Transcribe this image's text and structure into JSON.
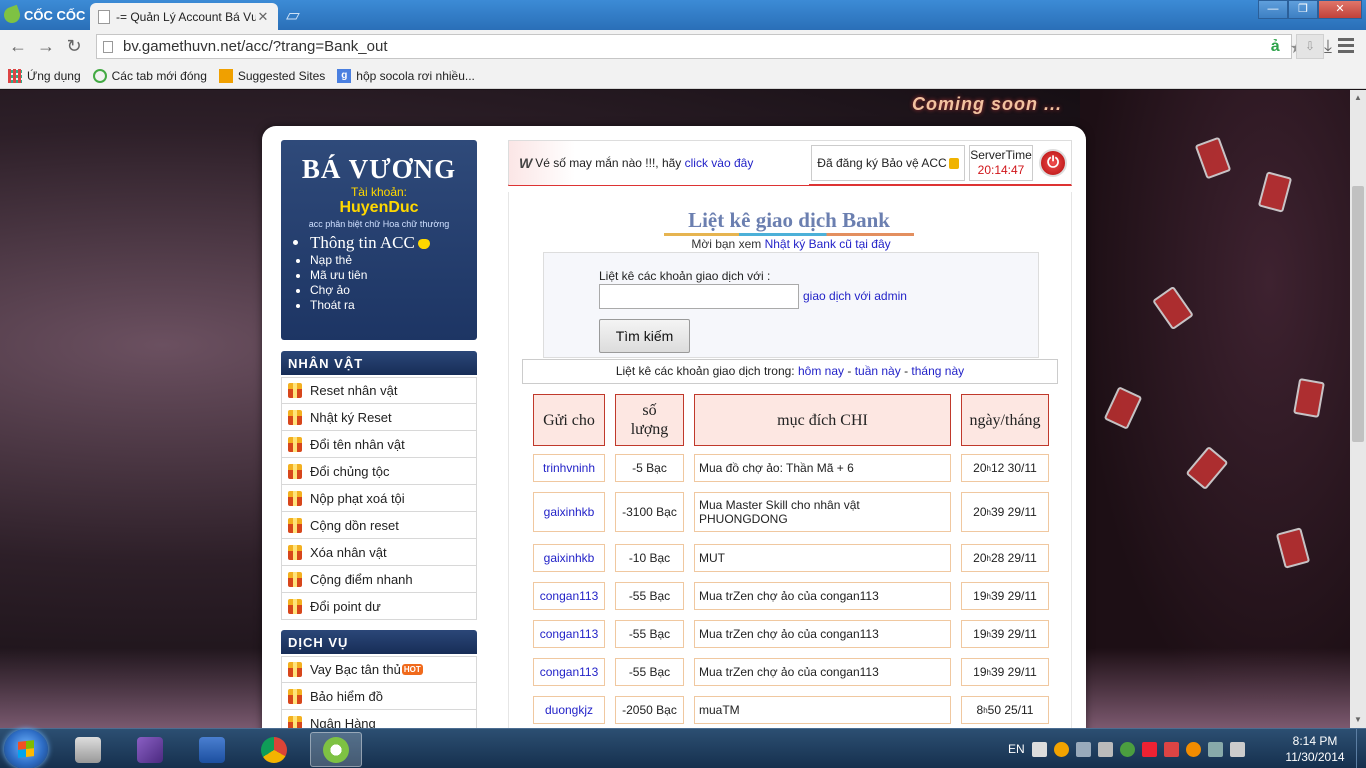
{
  "browser": {
    "brand": "CỐC CỐC",
    "tab_title": "-= Quản Lý Account Bá Vươ",
    "url": "bv.gamethuvn.net/acc/?trang=Bank_out",
    "bookmarks": [
      {
        "label": "Ứng dụng",
        "icon": "apps-grid-icon"
      },
      {
        "label": "Các tab mới đóng",
        "icon": "recent-tabs-icon"
      },
      {
        "label": "Suggested Sites",
        "icon": "bing-icon"
      },
      {
        "label": "hộp socola rơi nhiều...",
        "icon": "google-icon"
      }
    ]
  },
  "page": {
    "banner_text": "Coming soon ..."
  },
  "account": {
    "brand": "BÁ VƯƠNG",
    "account_label": "Tài khoản:",
    "username": "HuyenDuc",
    "note": "acc phân biệt chữ Hoa chữ thường",
    "menu": [
      "Thông tin ACC",
      "Nạp thẻ",
      "Mã ưu tiên",
      "Chợ ảo",
      "Thoát ra"
    ]
  },
  "sections": [
    {
      "title": "NHÂN VẬT",
      "items": [
        "Reset nhân vật",
        "Nhật ký Reset",
        "Đổi tên nhân vật",
        "Đổi chủng tộc",
        "Nộp phạt xoá tội",
        "Cộng dồn reset",
        "Xóa nhân vật",
        "Cộng điểm nhanh",
        "Đổi point dư"
      ]
    },
    {
      "title": "DỊCH VỤ",
      "items": [
        "Vay Bạc tân thủ",
        "Bảo hiểm đồ",
        "Ngân Hàng"
      ],
      "hot_badge": "HOT"
    }
  ],
  "topbar": {
    "lotto_logo": "W",
    "lotto_text": "Vé số may mắn nào !!!, hãy",
    "lotto_link": "click vào đây",
    "protect_text": "Đã đăng ký Bảo vệ ACC",
    "server_label": "ServerTime",
    "server_time": "20:14:47",
    "power_symbol": "⏻"
  },
  "content": {
    "title": "Liệt kê giao dịch Bank",
    "subtitle_prefix": "Mời bạn xem",
    "subtitle_link": "Nhật ký Bank cũ tại đây",
    "search_label": "Liệt kê các khoản giao dịch với :",
    "search_value": "",
    "admin_link": "giao dịch với admin",
    "search_button": "Tìm kiếm",
    "period_prefix": "Liệt kê các khoản giao dịch trong:",
    "period_today": "hôm nay",
    "period_sep": "-",
    "period_week": "tuần này",
    "period_month": "tháng này"
  },
  "table": {
    "headers": [
      "Gửi cho",
      "số lượng",
      "mục đích CHI",
      "ngày/tháng"
    ],
    "rows": [
      {
        "to": "trinhvninh",
        "amount": "-5 Bạc",
        "purpose": "Mua đồ chợ ảo: Thần Mã + 6",
        "hour": "20",
        "min_date": "12 30/11"
      },
      {
        "to": "gaixinhkb",
        "amount": "-3100 Bạc",
        "purpose": "Mua Master Skill cho nhân vật PHUONGDONG",
        "hour": "20",
        "min_date": "39 29/11"
      },
      {
        "to": "gaixinhkb",
        "amount": "-10 Bạc",
        "purpose": "MUT",
        "hour": "20",
        "min_date": "28 29/11"
      },
      {
        "to": "congan113",
        "amount": "-55 Bạc",
        "purpose": "Mua trZen chợ ảo của congan113",
        "hour": "19",
        "min_date": "39 29/11"
      },
      {
        "to": "congan113",
        "amount": "-55 Bạc",
        "purpose": "Mua trZen chợ ảo của congan113",
        "hour": "19",
        "min_date": "39 29/11"
      },
      {
        "to": "congan113",
        "amount": "-55 Bạc",
        "purpose": "Mua trZen chợ ảo của congan113",
        "hour": "19",
        "min_date": "39 29/11"
      },
      {
        "to": "duongkjz",
        "amount": "-2050 Bạc",
        "purpose": "muaTM",
        "hour": "8",
        "min_date": "50 25/11"
      }
    ],
    "hour_sup": "h"
  },
  "taskbar": {
    "apps": [
      "calculator-icon",
      "visual-studio-icon",
      "word-icon",
      "chrome-icon",
      "coccoc-icon"
    ],
    "lang": "EN",
    "time": "8:14 PM",
    "date": "11/30/2014"
  },
  "colors": {
    "nav_blue": "#1d3564",
    "link_blue": "#2323c8",
    "accent_red": "#d0151a",
    "header_pink": "#fde7e2"
  }
}
